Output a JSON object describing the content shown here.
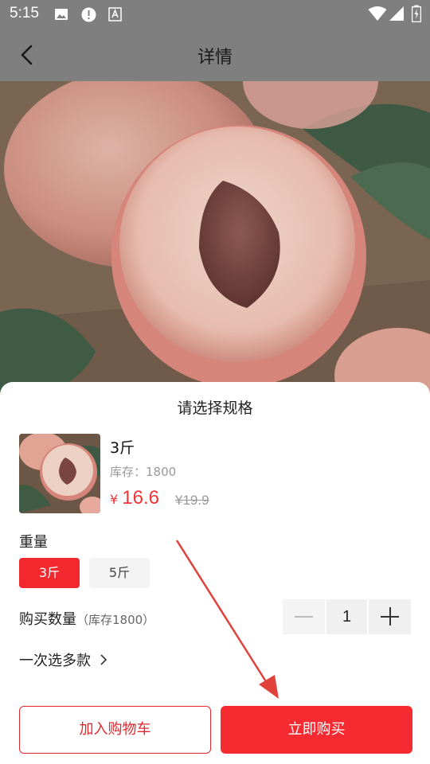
{
  "status_bar": {
    "time": "5:15"
  },
  "header": {
    "title": "详情"
  },
  "sheet": {
    "title": "请选择规格",
    "product": {
      "spec_name": "3斤",
      "stock_text": "库存：1800",
      "currency": "¥",
      "price": "16.6",
      "original_price": "¥19.9"
    },
    "weight": {
      "label": "重量",
      "options": [
        {
          "label": "3斤",
          "selected": true
        },
        {
          "label": "5斤",
          "selected": false
        }
      ]
    },
    "quantity": {
      "label": "购买数量",
      "hint": "（库存1800）",
      "value": "1"
    },
    "multi_select": {
      "label": "一次选多款"
    },
    "buttons": {
      "add_to_cart": "加入购物车",
      "buy_now": "立即购买"
    }
  },
  "colors": {
    "accent": "#f52b31",
    "price": "#ef3438",
    "annotation_arrow": "#e0413b"
  }
}
